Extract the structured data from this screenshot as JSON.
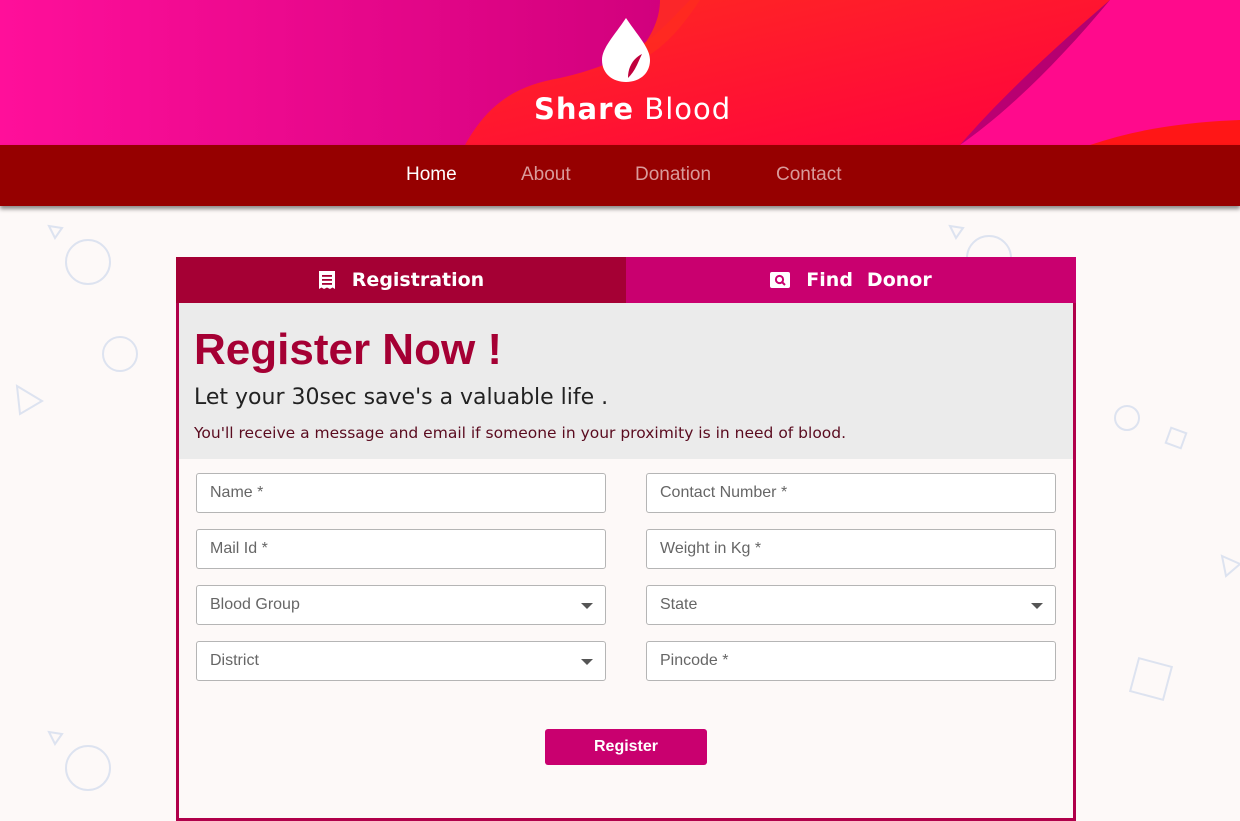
{
  "brand": {
    "name_bold": "Share",
    "name_rest": "Blood"
  },
  "colors": {
    "header_pink": "#ff1493",
    "header_red": "#ff1e1e",
    "nav_bg": "#960000",
    "accent": "#a50034",
    "tab_find": "#c9006f"
  },
  "nav": {
    "items": [
      {
        "label": "Home",
        "active": true
      },
      {
        "label": "About",
        "active": false
      },
      {
        "label": "Donation",
        "active": false
      },
      {
        "label": "Contact",
        "active": false
      }
    ]
  },
  "tabs": {
    "registration": {
      "label": "Registration",
      "icon": "receipt-icon"
    },
    "find_donor": {
      "label_1": "Find",
      "label_2": "Donor",
      "icon": "search-image-icon"
    }
  },
  "intro": {
    "title": "Register Now !",
    "subtitle": "Let your 30sec save's a valuable life .",
    "description": "You'll receive a message and email if someone in your proximity is in need of blood."
  },
  "form": {
    "name": {
      "placeholder": "Name *"
    },
    "contact": {
      "placeholder": "Contact Number *"
    },
    "mail": {
      "placeholder": "Mail Id *"
    },
    "weight": {
      "placeholder": "Weight in Kg *"
    },
    "blood_group": {
      "value": "Blood Group"
    },
    "state": {
      "value": "State"
    },
    "district": {
      "value": "District"
    },
    "pincode": {
      "placeholder": "Pincode *"
    },
    "submit_label": "Register"
  }
}
